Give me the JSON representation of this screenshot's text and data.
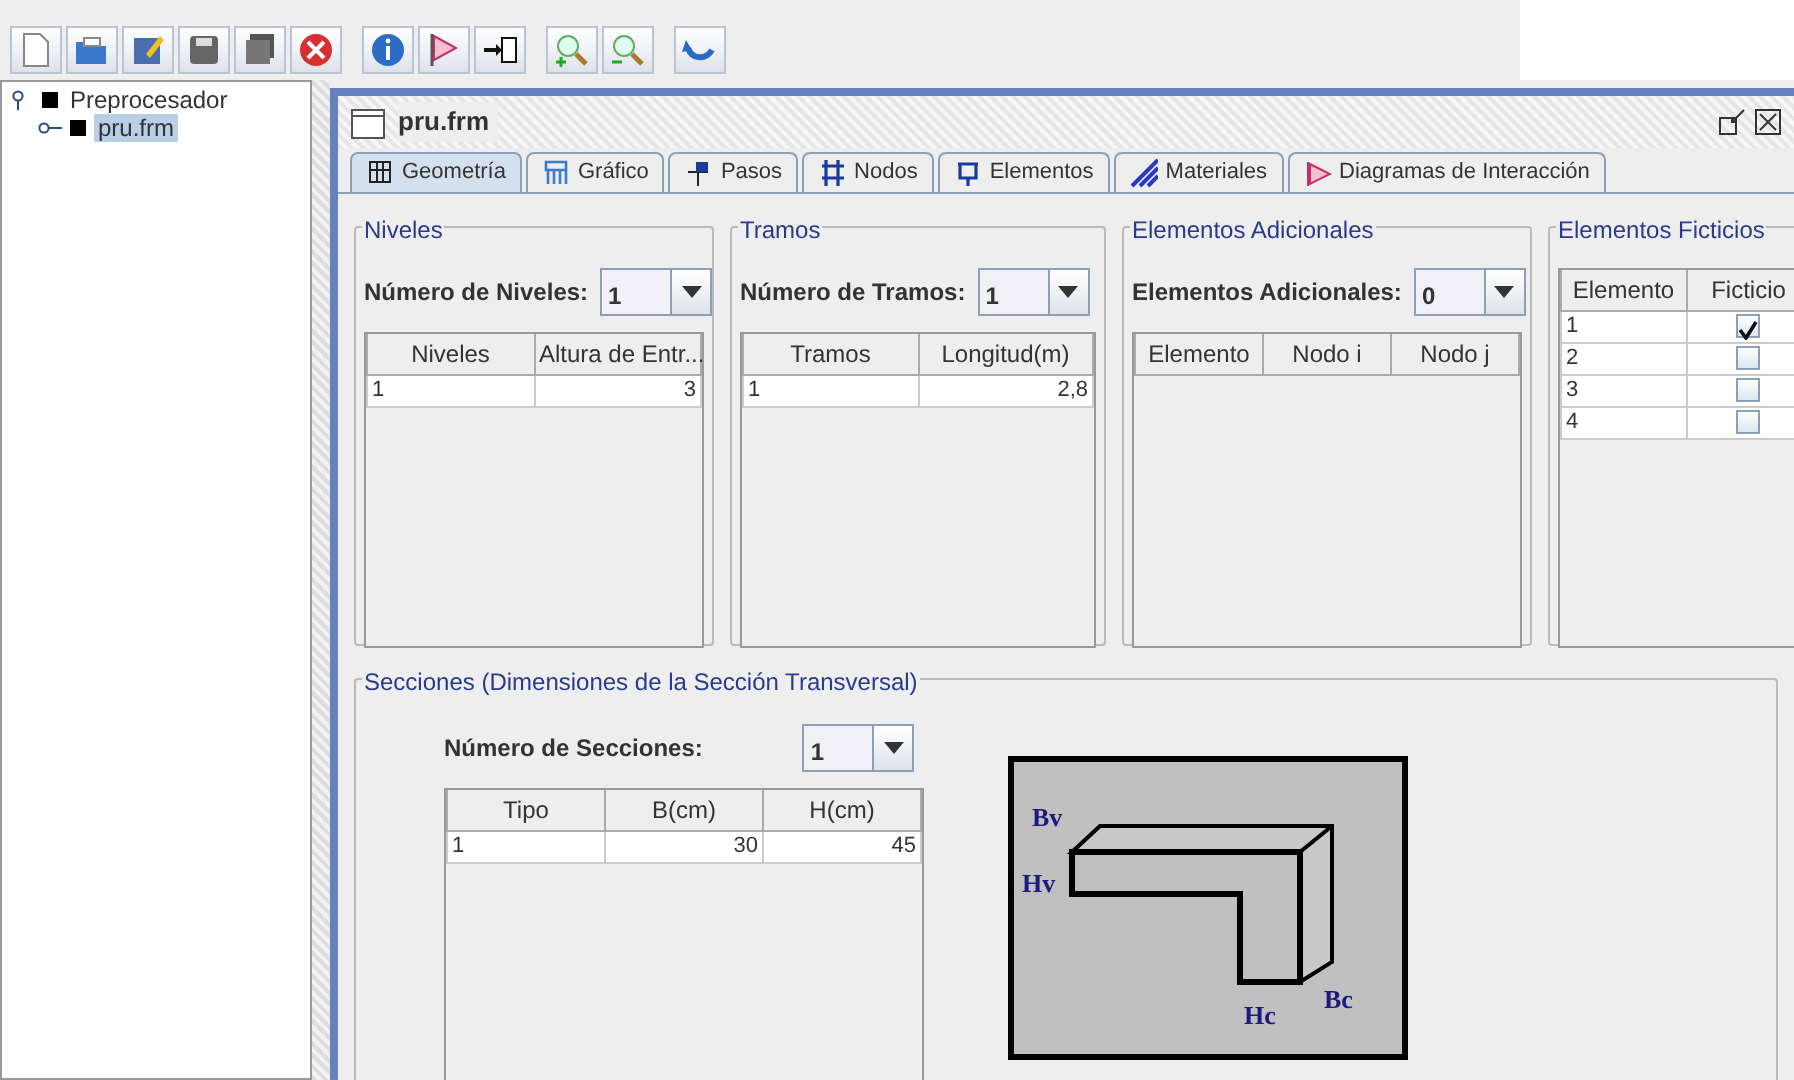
{
  "toolbar_groups": [
    [
      {
        "kind": "new"
      },
      {
        "kind": "open"
      },
      {
        "kind": "edit"
      },
      {
        "kind": "save"
      },
      {
        "kind": "save-all"
      },
      {
        "kind": "close"
      }
    ],
    [
      {
        "kind": "info"
      },
      {
        "kind": "flag"
      },
      {
        "kind": "export"
      }
    ],
    [
      {
        "kind": "zoom-in"
      },
      {
        "kind": "zoom-out"
      }
    ],
    [
      {
        "kind": "refresh"
      }
    ]
  ],
  "tree": [
    {
      "label": "Preprocesador",
      "selected": false,
      "children": [
        {
          "label": "pru.frm",
          "selected": true
        }
      ]
    }
  ],
  "frame": {
    "title": "pru.frm",
    "tabs": [
      {
        "label": "Geometría",
        "kind": "grid",
        "selected": true
      },
      {
        "label": "Gráfico",
        "kind": "chart",
        "selected": false
      },
      {
        "label": "Pasos",
        "kind": "steps",
        "selected": false
      },
      {
        "label": "Nodos",
        "kind": "nodes",
        "selected": false
      },
      {
        "label": "Elementos",
        "kind": "element",
        "selected": false
      },
      {
        "label": "Materiales",
        "kind": "materials",
        "selected": false
      },
      {
        "label": "Diagramas de Interacción",
        "kind": "diagram",
        "selected": false
      }
    ],
    "panels": [
      {
        "title": "Niveles",
        "count_label": "Número de Niveles:",
        "count_value": "1",
        "columns": [
          "Niveles",
          "Altura de Entr..."
        ],
        "rows": [
          [
            "1",
            "3"
          ]
        ]
      },
      {
        "title": "Tramos",
        "count_label": "Número de Tramos:",
        "count_value": "1",
        "columns": [
          "Tramos",
          "Longitud(m)"
        ],
        "rows": [
          [
            "1",
            "2,8"
          ]
        ]
      },
      {
        "title": "Elementos Adicionales",
        "count_label": "Elementos Adicionales:",
        "count_value": "0",
        "columns": [
          "Elemento",
          "Nodo i",
          "Nodo j"
        ]
      }
    ],
    "ficticios": {
      "title": "Elementos Ficticios",
      "columns": [
        "Elemento",
        "Ficticio"
      ],
      "rows": [
        {
          "elemento": "1",
          "checked": true
        },
        {
          "elemento": "2",
          "checked": false
        },
        {
          "elemento": "3",
          "checked": false
        },
        {
          "elemento": "4",
          "checked": false
        }
      ]
    },
    "secciones": {
      "title": "Secciones (Dimensiones de la Sección Transversal)",
      "count_label": "Número de Secciones:",
      "count_value": "1",
      "columns": [
        "Tipo",
        "B(cm)",
        "H(cm)"
      ],
      "rows": [
        [
          "1",
          "30",
          "45"
        ]
      ],
      "diagram_labels": {
        "bv": "Bv",
        "hv": "Hv",
        "hc": "Hc",
        "bc": "Bc"
      }
    }
  }
}
